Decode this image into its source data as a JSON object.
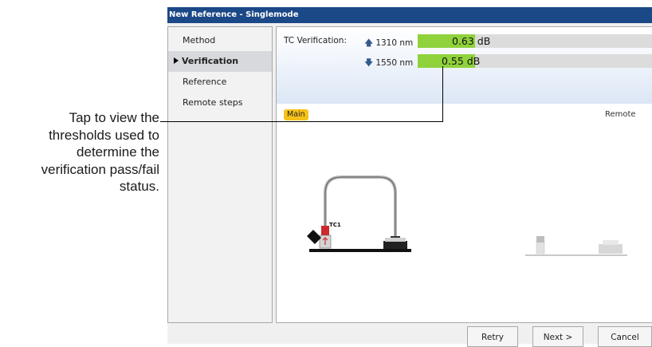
{
  "callout": {
    "lines": [
      "Tap to view the",
      "thresholds used to",
      "determine the",
      "verification pass/fail",
      "status."
    ]
  },
  "window": {
    "title": "New Reference - Singlemode"
  },
  "sidebar": {
    "items": [
      {
        "label": "Method",
        "active": false
      },
      {
        "label": "Verification",
        "active": true
      },
      {
        "label": "Reference",
        "active": false
      },
      {
        "label": "Remote steps",
        "active": false
      }
    ]
  },
  "tc_verification": {
    "label": "TC Verification:",
    "rows": [
      {
        "direction_icon": "arrow-up-icon",
        "wavelength": "1310 nm",
        "value": "0.63 dB",
        "fill_percent": 24
      },
      {
        "direction_icon": "arrow-down-icon",
        "wavelength": "1550 nm",
        "value": "0.55 dB",
        "fill_percent": 24
      }
    ],
    "pass_color": "#8fd23c"
  },
  "tabs": {
    "main_label": "Main",
    "remote_label": "Remote"
  },
  "diagram": {
    "tc_label": "TC1"
  },
  "buttons": {
    "retry": "Retry",
    "next": "Next >",
    "cancel": "Cancel"
  },
  "colors": {
    "titlebar": "#1b4886",
    "badge": "#f6c21a"
  }
}
